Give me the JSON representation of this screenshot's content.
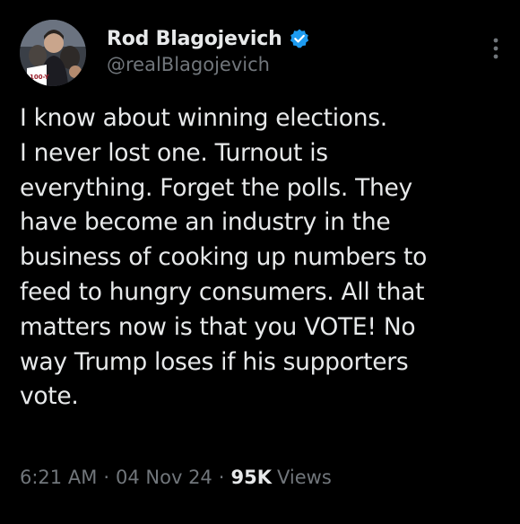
{
  "author": {
    "display_name": "Rod Blagojevich",
    "handle": "@realBlagojevich",
    "verified": true,
    "avatar_icon": "profile-photo-icon",
    "avatar_sign_text": "100-Y"
  },
  "menu": {
    "icon": "more-vertical-icon"
  },
  "tweet": {
    "text": "I know about winning elections.\nI never lost one. Turnout is\neverything. Forget the polls. They\nhave become an industry in the\nbusiness of cooking up numbers to\nfeed to hungry consumers. All that\nmatters now is that you VOTE! No\nway Trump loses if his supporters\nvote."
  },
  "meta": {
    "time": "6:21 AM",
    "separator": "·",
    "date": "04 Nov 24",
    "views_count": "95K",
    "views_label": "Views"
  },
  "colors": {
    "background": "#000000",
    "primary_text": "#e7e9ea",
    "secondary_text": "#71767b",
    "verified_badge": "#1d9bf0"
  }
}
